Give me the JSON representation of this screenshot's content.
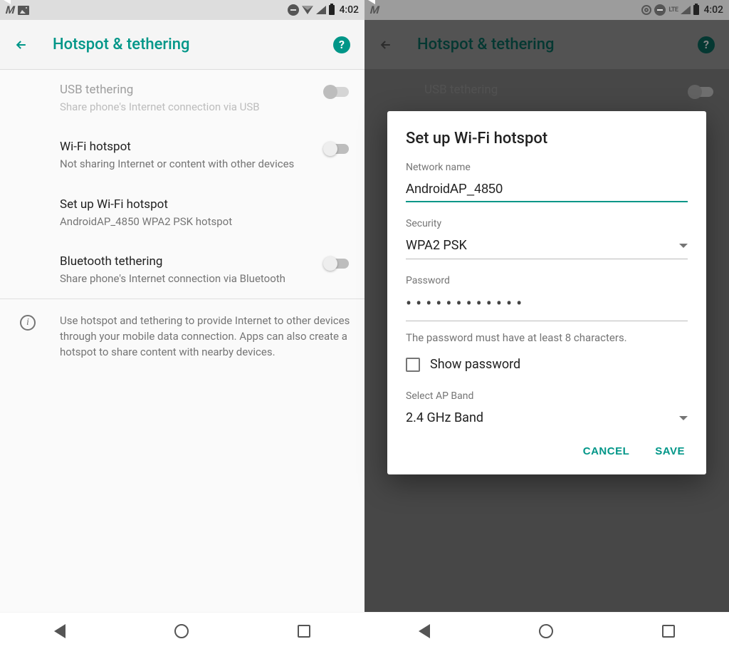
{
  "status": {
    "time": "4:02"
  },
  "header": {
    "title": "Hotspot & tethering"
  },
  "settings": {
    "usb": {
      "title": "USB tethering",
      "sub": "Share phone's Internet connection via USB"
    },
    "wifi": {
      "title": "Wi-Fi hotspot",
      "sub": "Not sharing Internet or content with other devices"
    },
    "setup": {
      "title": "Set up Wi-Fi hotspot",
      "sub": "AndroidAP_4850 WPA2 PSK hotspot"
    },
    "bt": {
      "title": "Bluetooth tethering",
      "sub": "Share phone's Internet connection via Bluetooth"
    },
    "info": "Use hotspot and tethering to provide Internet to other devices through your mobile data connection. Apps can also create a hotspot to share content with nearby devices."
  },
  "dialog": {
    "title": "Set up Wi-Fi hotspot",
    "network_label": "Network name",
    "network_value": "AndroidAP_4850",
    "security_label": "Security",
    "security_value": "WPA2 PSK",
    "password_label": "Password",
    "password_dots": "••••••••••••",
    "password_hint": "The password must have at least 8 characters.",
    "show_password": "Show password",
    "band_label": "Select AP Band",
    "band_value": "2.4 GHz Band",
    "cancel": "CANCEL",
    "save": "SAVE"
  },
  "right_lte": "LTE"
}
